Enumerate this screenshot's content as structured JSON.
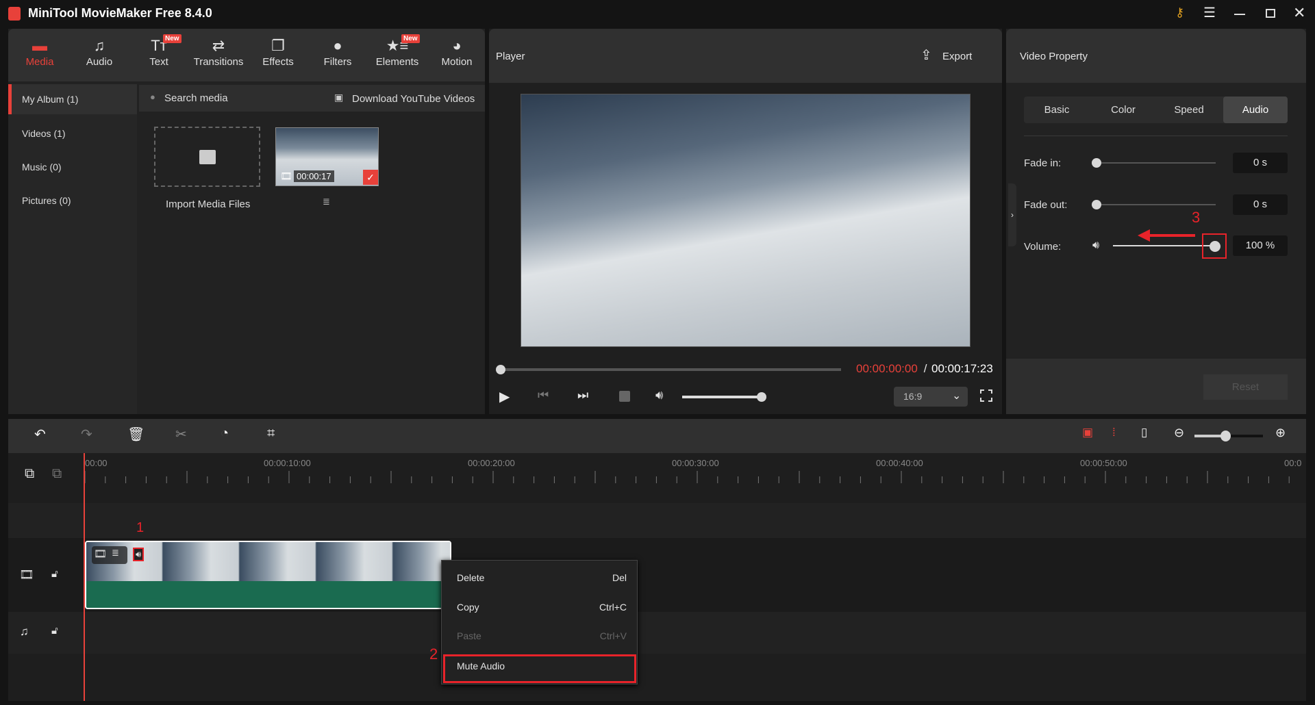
{
  "app": {
    "title": "MiniTool MovieMaker Free 8.4.0"
  },
  "toolbar": {
    "tabs": [
      {
        "label": "Media",
        "icon": "folder-icon",
        "active": true
      },
      {
        "label": "Audio",
        "icon": "music-note-icon"
      },
      {
        "label": "Text",
        "icon": "text-icon",
        "badge": "New"
      },
      {
        "label": "Transitions",
        "icon": "swap-arrows-icon"
      },
      {
        "label": "Effects",
        "icon": "layers-icon"
      },
      {
        "label": "Filters",
        "icon": "filters-icon"
      },
      {
        "label": "Elements",
        "icon": "star-list-icon",
        "badge": "New"
      },
      {
        "label": "Motion",
        "icon": "motion-icon"
      }
    ]
  },
  "sidebar": {
    "items": [
      {
        "label": "My Album (1)"
      },
      {
        "label": "Videos (1)"
      },
      {
        "label": "Music (0)"
      },
      {
        "label": "Pictures (0)"
      }
    ]
  },
  "media": {
    "search_placeholder": "Search media",
    "download_label": "Download YouTube Videos",
    "import_label": "Import Media Files",
    "clip_duration": "00:00:17"
  },
  "player": {
    "title": "Player",
    "export_label": "Export",
    "current_time": "00:00:00:00",
    "separator": " / ",
    "total_time": "00:00:17:23",
    "aspect_ratio": "16:9",
    "progress": 0,
    "volume": 1.0
  },
  "property": {
    "title": "Video Property",
    "tabs": [
      "Basic",
      "Color",
      "Speed",
      "Audio"
    ],
    "active_tab": "Audio",
    "fade_in_label": "Fade in:",
    "fade_in_value": "0 s",
    "fade_out_label": "Fade out:",
    "fade_out_value": "0 s",
    "volume_label": "Volume:",
    "volume_value": "100 %",
    "reset_label": "Reset"
  },
  "timeline": {
    "ruler_labels": [
      "00:00",
      "00:00:10:00",
      "00:00:20:00",
      "00:00:30:00",
      "00:00:40:00",
      "00:00:50:00",
      "00:0"
    ],
    "zoom_level": 0.45
  },
  "context_menu": {
    "items": [
      {
        "label": "Delete",
        "shortcut": "Del"
      },
      {
        "label": "Copy",
        "shortcut": "Ctrl+C"
      },
      {
        "label": "Paste",
        "shortcut": "Ctrl+V",
        "disabled": true
      },
      {
        "label": "Mute Audio",
        "shortcut": ""
      }
    ]
  },
  "annotations": {
    "step1": "1",
    "step2": "2",
    "step3": "3"
  },
  "colors": {
    "accent": "#e8413a",
    "clip_audio": "#1a6b50"
  }
}
